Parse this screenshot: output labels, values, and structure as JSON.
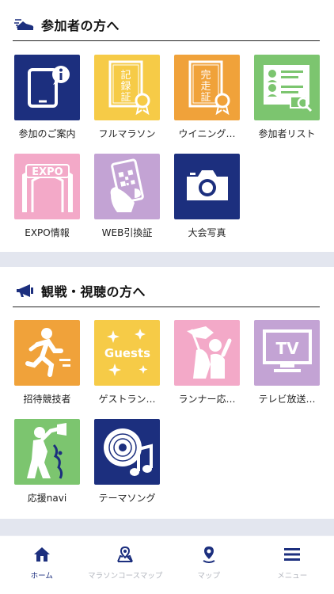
{
  "colors": {
    "navy": "#1c2f7e",
    "yellow": "#f6cb47",
    "orange": "#f0a23a",
    "green": "#7cc56f",
    "pink": "#f3a9c8",
    "lavender": "#c3a3d4",
    "separator": "#e3e6ef"
  },
  "participants": {
    "title": "参加者の方へ",
    "icon": "running-shoe-icon",
    "items": [
      {
        "label": "参加のご案内",
        "icon": "smartphone-info-icon",
        "color": "#1c2f7e"
      },
      {
        "label": "フルマラソン",
        "icon": "certificate-icon",
        "color": "#f6cb47",
        "badge": "記録証"
      },
      {
        "label": "ウイニング…",
        "icon": "certificate-icon",
        "color": "#f0a23a",
        "badge": "完走証"
      },
      {
        "label": "参加者リスト",
        "icon": "search-list-icon",
        "color": "#7cc56f"
      },
      {
        "label": "EXPO情報",
        "icon": "expo-gate-icon",
        "color": "#f3a9c8",
        "badge": "EXPO"
      },
      {
        "label": "WEB引換証",
        "icon": "qr-phone-icon",
        "color": "#c3a3d4"
      },
      {
        "label": "大会写真",
        "icon": "camera-icon",
        "color": "#1c2f7e"
      }
    ]
  },
  "spectators": {
    "title": "観戦・視聴の方へ",
    "icon": "megaphone-icon",
    "items": [
      {
        "label": "招待競技者",
        "icon": "runner-icon",
        "color": "#f0a23a"
      },
      {
        "label": "ゲストラン…",
        "icon": "guests-icon",
        "color": "#f6cb47",
        "badge": "Guests"
      },
      {
        "label": "ランナー応…",
        "icon": "cheering-flag-icon",
        "color": "#f3a9c8"
      },
      {
        "label": "テレビ放送…",
        "icon": "tv-icon",
        "color": "#c3a3d4",
        "badge": "TV"
      },
      {
        "label": "応援navi",
        "icon": "cheering-person-icon",
        "color": "#7cc56f"
      },
      {
        "label": "テーマソング",
        "icon": "music-disc-icon",
        "color": "#1c2f7e"
      }
    ]
  },
  "nav": [
    {
      "label": "ホーム",
      "icon": "home-icon",
      "active": true
    },
    {
      "label": "マラソンコースマップ",
      "icon": "course-map-icon",
      "active": false
    },
    {
      "label": "マップ",
      "icon": "map-pin-icon",
      "active": false
    },
    {
      "label": "メニュー",
      "icon": "hamburger-icon",
      "active": false
    }
  ]
}
